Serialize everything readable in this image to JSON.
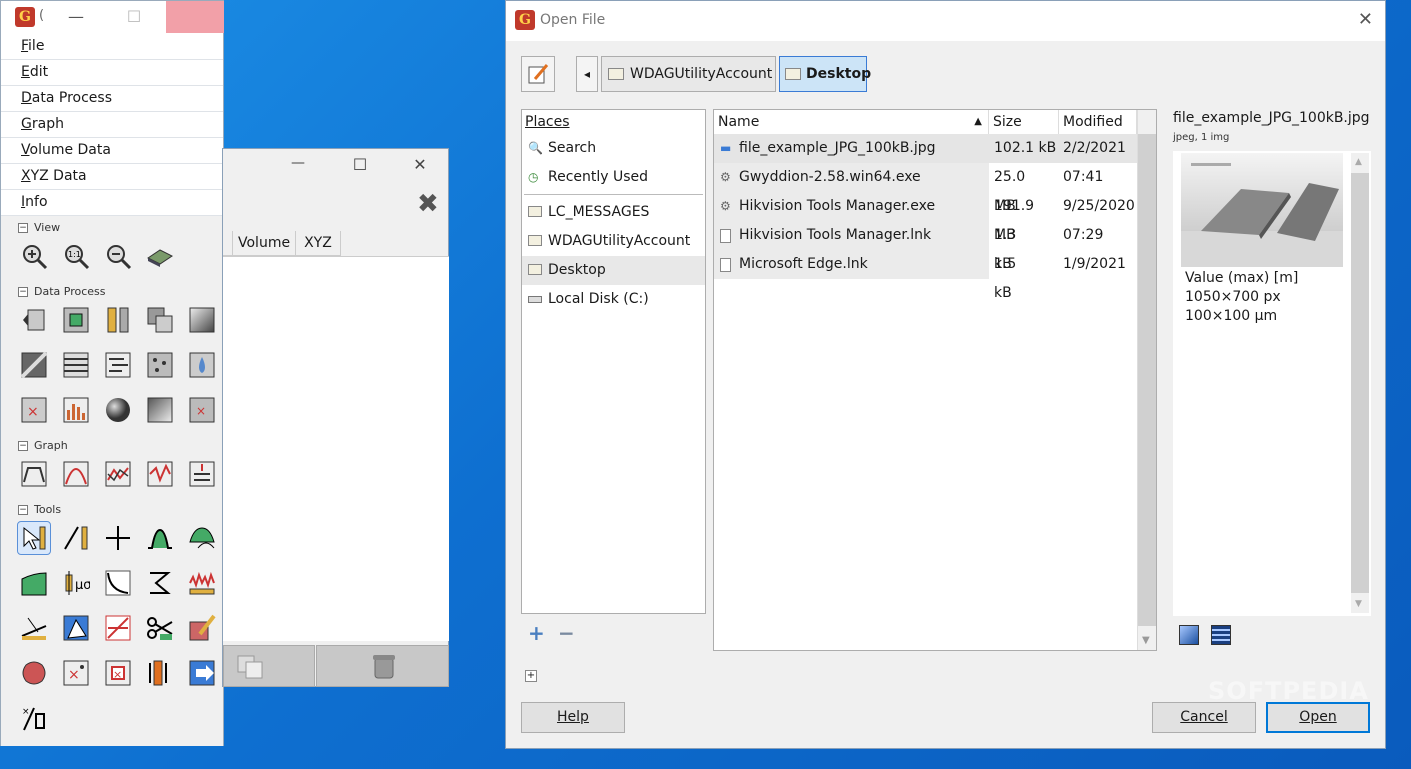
{
  "toolbox": {
    "title_letter": "G",
    "title_short": "(",
    "minimize": "—",
    "maximize": "☐",
    "menu": [
      "File",
      "Edit",
      "Data Process",
      "Graph",
      "Volume Data",
      "XYZ Data",
      "Info"
    ],
    "sections": {
      "view": "View",
      "data_process": "Data Process",
      "graph": "Graph",
      "tools": "Tools"
    },
    "collapse_sign": "−"
  },
  "data_browser": {
    "minimize": "—",
    "maximize": "☐",
    "close": "✕",
    "delete": "✖",
    "tabs": [
      "Volume",
      "XYZ"
    ]
  },
  "dialog": {
    "title": "Open File",
    "close": "✕",
    "back_arrow": "◂",
    "breadcrumbs": [
      "WDAGUtilityAccount",
      "Desktop"
    ],
    "places_header": "Places",
    "places": [
      {
        "label": "Search",
        "icon": "search-icon"
      },
      {
        "label": "Recently Used",
        "icon": "clock-icon"
      },
      {
        "label": "LC_MESSAGES",
        "icon": "folder-icon"
      },
      {
        "label": "WDAGUtilityAccount",
        "icon": "folder-icon"
      },
      {
        "label": "Desktop",
        "icon": "folder-icon"
      },
      {
        "label": "Local Disk (C:)",
        "icon": "drive-icon"
      }
    ],
    "add": "+",
    "remove": "−",
    "columns": {
      "name": "Name",
      "size": "Size",
      "modified": "Modified"
    },
    "files": [
      {
        "name": "file_example_JPG_100kB.jpg",
        "size": "102.1 kB",
        "modified": "2/2/2021",
        "icon": "image-file-icon"
      },
      {
        "name": "Gwyddion-2.58.win64.exe",
        "size": "25.0 MB",
        "modified": "07:41",
        "icon": "executable-icon"
      },
      {
        "name": "Hikvision Tools Manager.exe",
        "size": "191.9 MB",
        "modified": "9/25/2020",
        "icon": "executable-icon"
      },
      {
        "name": "Hikvision Tools Manager.lnk",
        "size": "1.3 kB",
        "modified": "07:29",
        "icon": "document-icon"
      },
      {
        "name": "Microsoft Edge.lnk",
        "size": "1.5 kB",
        "modified": "1/9/2021",
        "icon": "document-icon"
      }
    ],
    "preview": {
      "filename": "file_example_JPG_100kB.jpg",
      "subtitle": "jpeg, 1 img",
      "lines": [
        "Value (max) [m]",
        "1050×700 px",
        "100×100 µm"
      ]
    },
    "expander": "+",
    "help": "Help",
    "cancel": "Cancel",
    "open": "Open"
  },
  "watermark": "SOFTPEDIA"
}
